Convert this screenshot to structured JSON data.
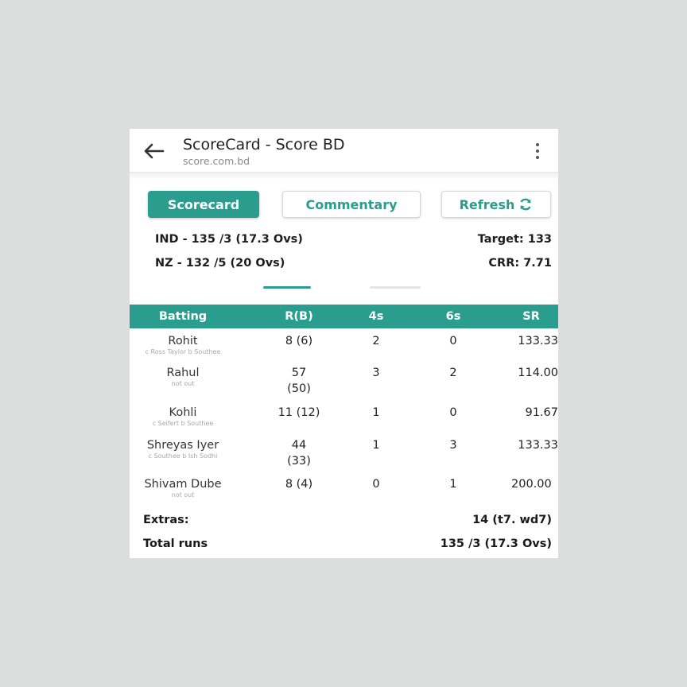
{
  "header": {
    "title": "ScoreCard - Score BD",
    "url": "score.com.bd"
  },
  "buttons": {
    "scorecard": "Scorecard",
    "commentary": "Commentary",
    "refresh": "Refresh"
  },
  "summary": {
    "ind": "IND - 135 /3 (17.3 Ovs)",
    "nz": "NZ - 132 /5 (20 Ovs)",
    "target": "Target: 133",
    "crr": "CRR:  7.71"
  },
  "table": {
    "headers": [
      "Batting",
      "R(B)",
      "4s",
      "6s",
      "SR"
    ],
    "rows": [
      {
        "name": "Rohit",
        "dismissal": "c Ross Taylor b Southee",
        "runs": "8 (6)",
        "runs2": "",
        "fours": "2",
        "sixes": "0",
        "sr": "133.33"
      },
      {
        "name": "Rahul",
        "dismissal": "not out",
        "runs": "57",
        "runs2": "(50)",
        "fours": "3",
        "sixes": "2",
        "sr": "114.00"
      },
      {
        "name": "Kohli",
        "dismissal": "c Seifert b Southee",
        "runs": "11 (12)",
        "runs2": "",
        "fours": "1",
        "sixes": "0",
        "sr": "91.67"
      },
      {
        "name": "Shreyas Iyer",
        "dismissal": "c Southee b Ish Sodhi",
        "runs": "44",
        "runs2": "(33)",
        "fours": "1",
        "sixes": "3",
        "sr": "133.33"
      },
      {
        "name": "Shivam Dube",
        "dismissal": "not out",
        "runs": "8 (4)",
        "runs2": "",
        "fours": "0",
        "sixes": "1",
        "sr": "200.00"
      }
    ]
  },
  "footer": {
    "extras_label": "Extras:",
    "extras_value": "14 (t7. wd7)",
    "total_label": "Total runs",
    "total_value": "135 /3 (17.3 Ovs)"
  },
  "colors": {
    "accent": "#2a9d8f"
  }
}
